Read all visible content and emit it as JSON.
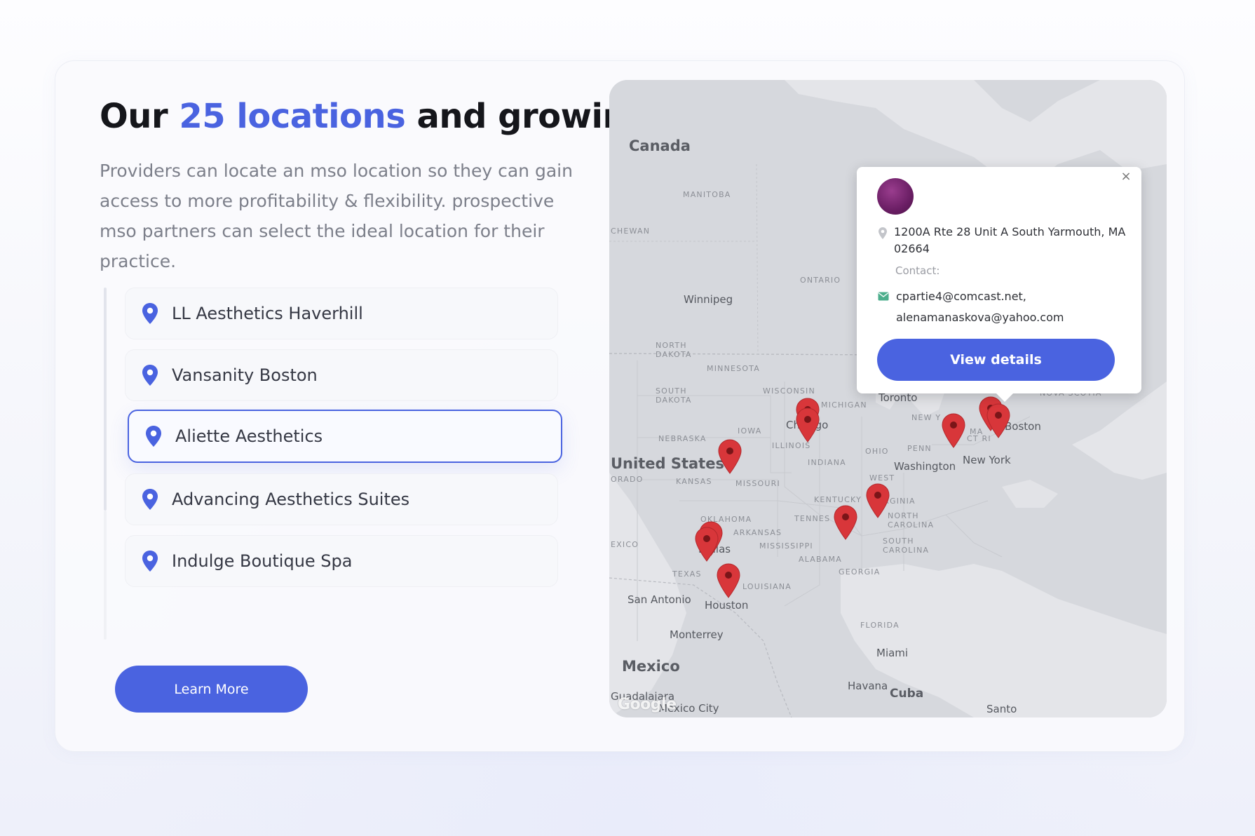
{
  "headline": {
    "prefix": "Our",
    "highlight": "25 locations",
    "suffix": "and growing"
  },
  "description": "Providers can locate an mso location so they can gain access to more profitability & flexibility. prospective mso partners can select the ideal location for their practice.",
  "locations": [
    {
      "label": "LL Aesthetics Haverhill",
      "selected": false
    },
    {
      "label": "Vansanity Boston",
      "selected": false
    },
    {
      "label": "Aliette Aesthetics",
      "selected": true
    },
    {
      "label": "Advancing Aesthetics Suites",
      "selected": false
    },
    {
      "label": "Indulge Boutique Spa",
      "selected": false
    }
  ],
  "learn_more_label": "Learn More",
  "map": {
    "countries": [
      "Canada",
      "United States",
      "Mexico",
      "Cuba"
    ],
    "regions": [
      "MANITOBA",
      "CHEWAN",
      "ONTARIO",
      "NORTH DAKOTA",
      "MINNESOTA",
      "SOUTH DAKOTA",
      "WISCONSIN",
      "MICHIGAN",
      "IOWA",
      "NEBRASKA",
      "ILLINOIS",
      "OHIO",
      "PENN",
      "INDIANA",
      "KANSAS",
      "MISSOURI",
      "ORADO",
      "WEST",
      "VIRGINIA",
      "KENTUCKY",
      "NORTH CAROLINA",
      "TENNES",
      "OKLAHOMA",
      "ARKANSAS",
      "MISSISSIPPI",
      "SOUTH CAROLINA",
      "EXICO",
      "ALABAMA",
      "GEORGIA",
      "TEXAS",
      "LOUISIANA",
      "FLORIDA",
      "NEW Y",
      "MA",
      "CT RI",
      "NOVA SCOTIA"
    ],
    "cities": [
      "Winnipeg",
      "Toronto",
      "Chicago",
      "Washington",
      "New York",
      "Boston",
      "Dallas",
      "Houston",
      "San Antonio",
      "Monterrey",
      "Miami",
      "Havana",
      "Guadalajara",
      "Mexico City",
      "Santo"
    ],
    "attribution": "Google",
    "popup": {
      "address": "1200A Rte 28 Unit A South Yarmouth, MA 02664",
      "contact_label": "Contact:",
      "email_1": "cpartie4@comcast.net,",
      "email_2": "alenamanaskova@yahoo.com",
      "button_label": "View details",
      "close_symbol": "×"
    }
  },
  "colors": {
    "accent": "#4a63e0",
    "marker": "#d8363a",
    "heading": "#15161b",
    "body_text": "#7c7f8a"
  }
}
